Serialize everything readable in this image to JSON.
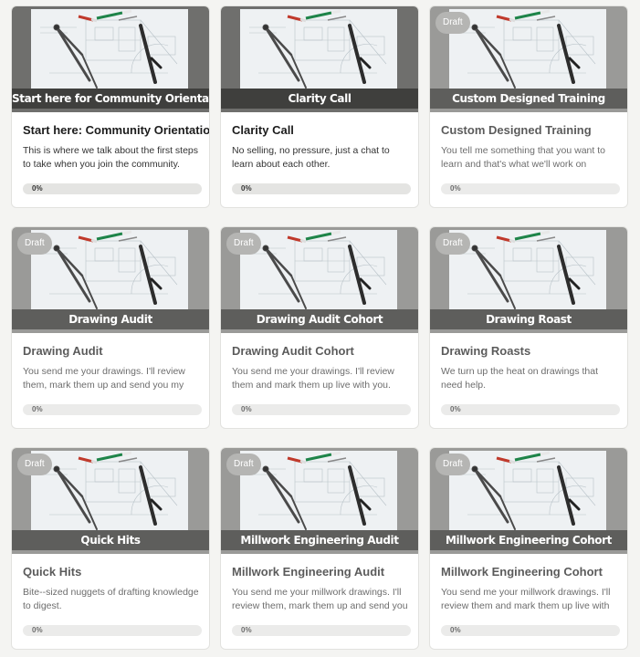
{
  "courses": [
    {
      "banner": "Start here for Community Orientation",
      "title": "Start here: Community Orientation",
      "description": "This is where we talk about the first steps to take when you join the community.",
      "progress": "0%",
      "draft": false
    },
    {
      "banner": "Clarity Call",
      "title": "Clarity Call",
      "description": "No selling, no pressure, just a chat to learn about each other.",
      "progress": "0%",
      "draft": false
    },
    {
      "banner": "Custom Designed Training",
      "title": "Custom Designed Training",
      "description": "You tell me something that you want to learn and that's what we'll work on together.",
      "progress": "0%",
      "draft": true
    },
    {
      "banner": "Drawing Audit",
      "title": "Drawing Audit",
      "description": "You send me your drawings. I'll review them, mark them up and send you my notes.",
      "progress": "0%",
      "draft": true
    },
    {
      "banner": "Drawing Audit Cohort",
      "title": "Drawing Audit Cohort",
      "description": "You send me your drawings. I'll review them and mark them up live with you.",
      "progress": "0%",
      "draft": true
    },
    {
      "banner": "Drawing Roast",
      "title": "Drawing Roasts",
      "description": "We turn up the heat on drawings that need help.",
      "progress": "0%",
      "draft": true
    },
    {
      "banner": "Quick Hits",
      "title": "Quick Hits",
      "description": "Bite--sized nuggets of drafting knowledge to digest.",
      "progress": "0%",
      "draft": true
    },
    {
      "banner": "Millwork Engineering Audit",
      "title": "Millwork Engineering Audit",
      "description": "You send me your millwork drawings. I'll review them, mark them up and send you m...",
      "progress": "0%",
      "draft": true
    },
    {
      "banner": "Millwork Engineering Cohort",
      "title": "Millwork Engineering Cohort",
      "description": "You send me your millwork drawings. I'll review them and mark them up live with you.",
      "progress": "0%",
      "draft": true
    }
  ],
  "draft_label": "Draft",
  "colors": {
    "pen_red": "#c0392b",
    "pen_green": "#1e8449",
    "banner_bg": "#3f3f3d"
  }
}
